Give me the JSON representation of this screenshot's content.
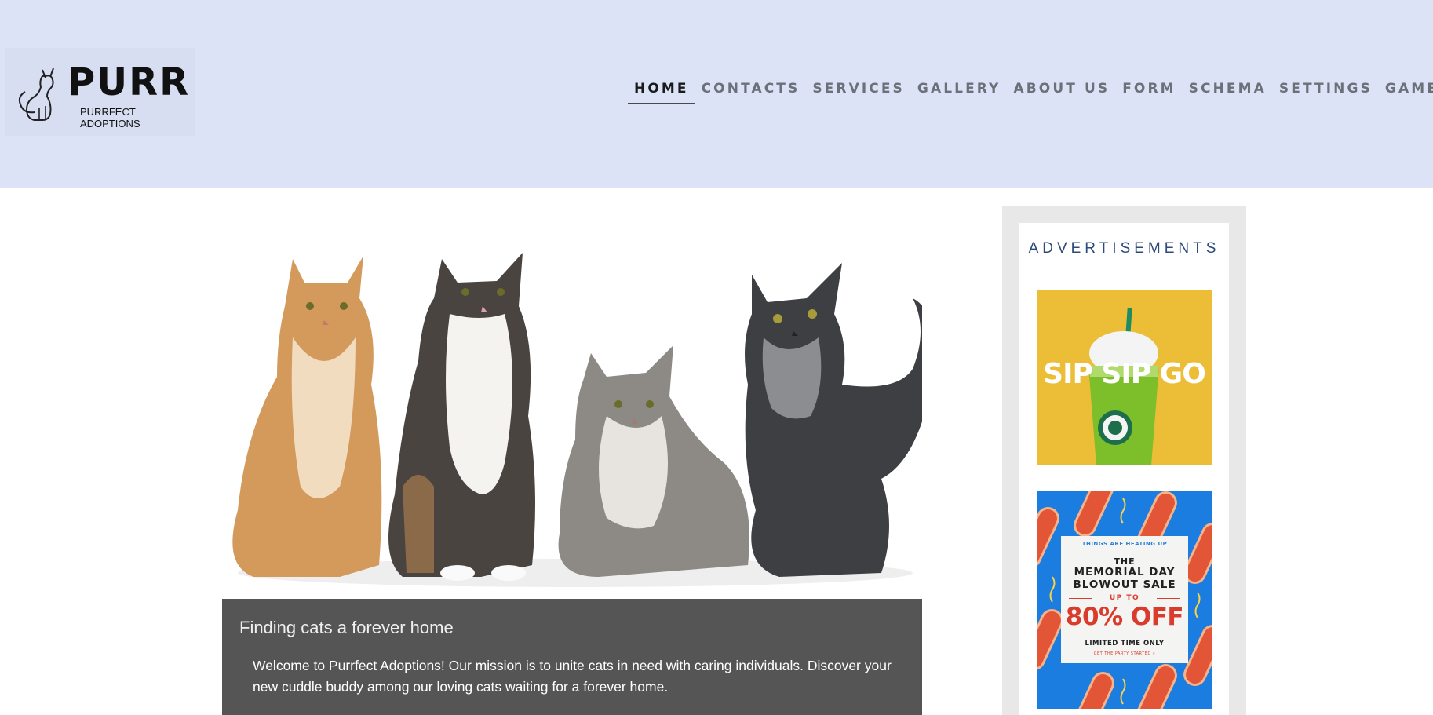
{
  "brand": {
    "name": "PURR",
    "tagline": "PURRFECT ADOPTIONS"
  },
  "nav": {
    "items": [
      {
        "label": "HOME",
        "active": true
      },
      {
        "label": "CONTACTS",
        "active": false
      },
      {
        "label": "SERVICES",
        "active": false
      },
      {
        "label": "GALLERY",
        "active": false
      },
      {
        "label": "ABOUT US",
        "active": false
      },
      {
        "label": "FORM",
        "active": false
      },
      {
        "label": "SCHEMA",
        "active": false
      },
      {
        "label": "SETTINGS",
        "active": false
      },
      {
        "label": "GAME",
        "active": false
      }
    ]
  },
  "hero": {
    "caption_title": "Finding cats a forever home",
    "caption_text": "Welcome to Purrfect Adoptions! Our mission is to unite cats in need with caring individuals. Discover your new cuddle buddy among our loving cats waiting for a forever home."
  },
  "sidebar": {
    "title": "ADVERTISEMENTS",
    "ad1": {
      "text": "SIP SIP GO"
    },
    "ad2": {
      "top": "THINGS ARE HEATING UP",
      "the": "THE",
      "line1": "MEMORIAL DAY",
      "line2": "BLOWOUT SALE",
      "upto": "UP TO",
      "big": "80% OFF",
      "limited": "LIMITED TIME ONLY",
      "small": "GET THE PARTY STARTED »"
    }
  },
  "colors": {
    "header_bg": "#dde3f7",
    "caption_bg": "#555555",
    "ads_title": "#2c4a7c",
    "ad1_bg": "#ecbd37",
    "ad2_bg": "#1a7ddf",
    "ad2_accent": "#d93c2c"
  }
}
